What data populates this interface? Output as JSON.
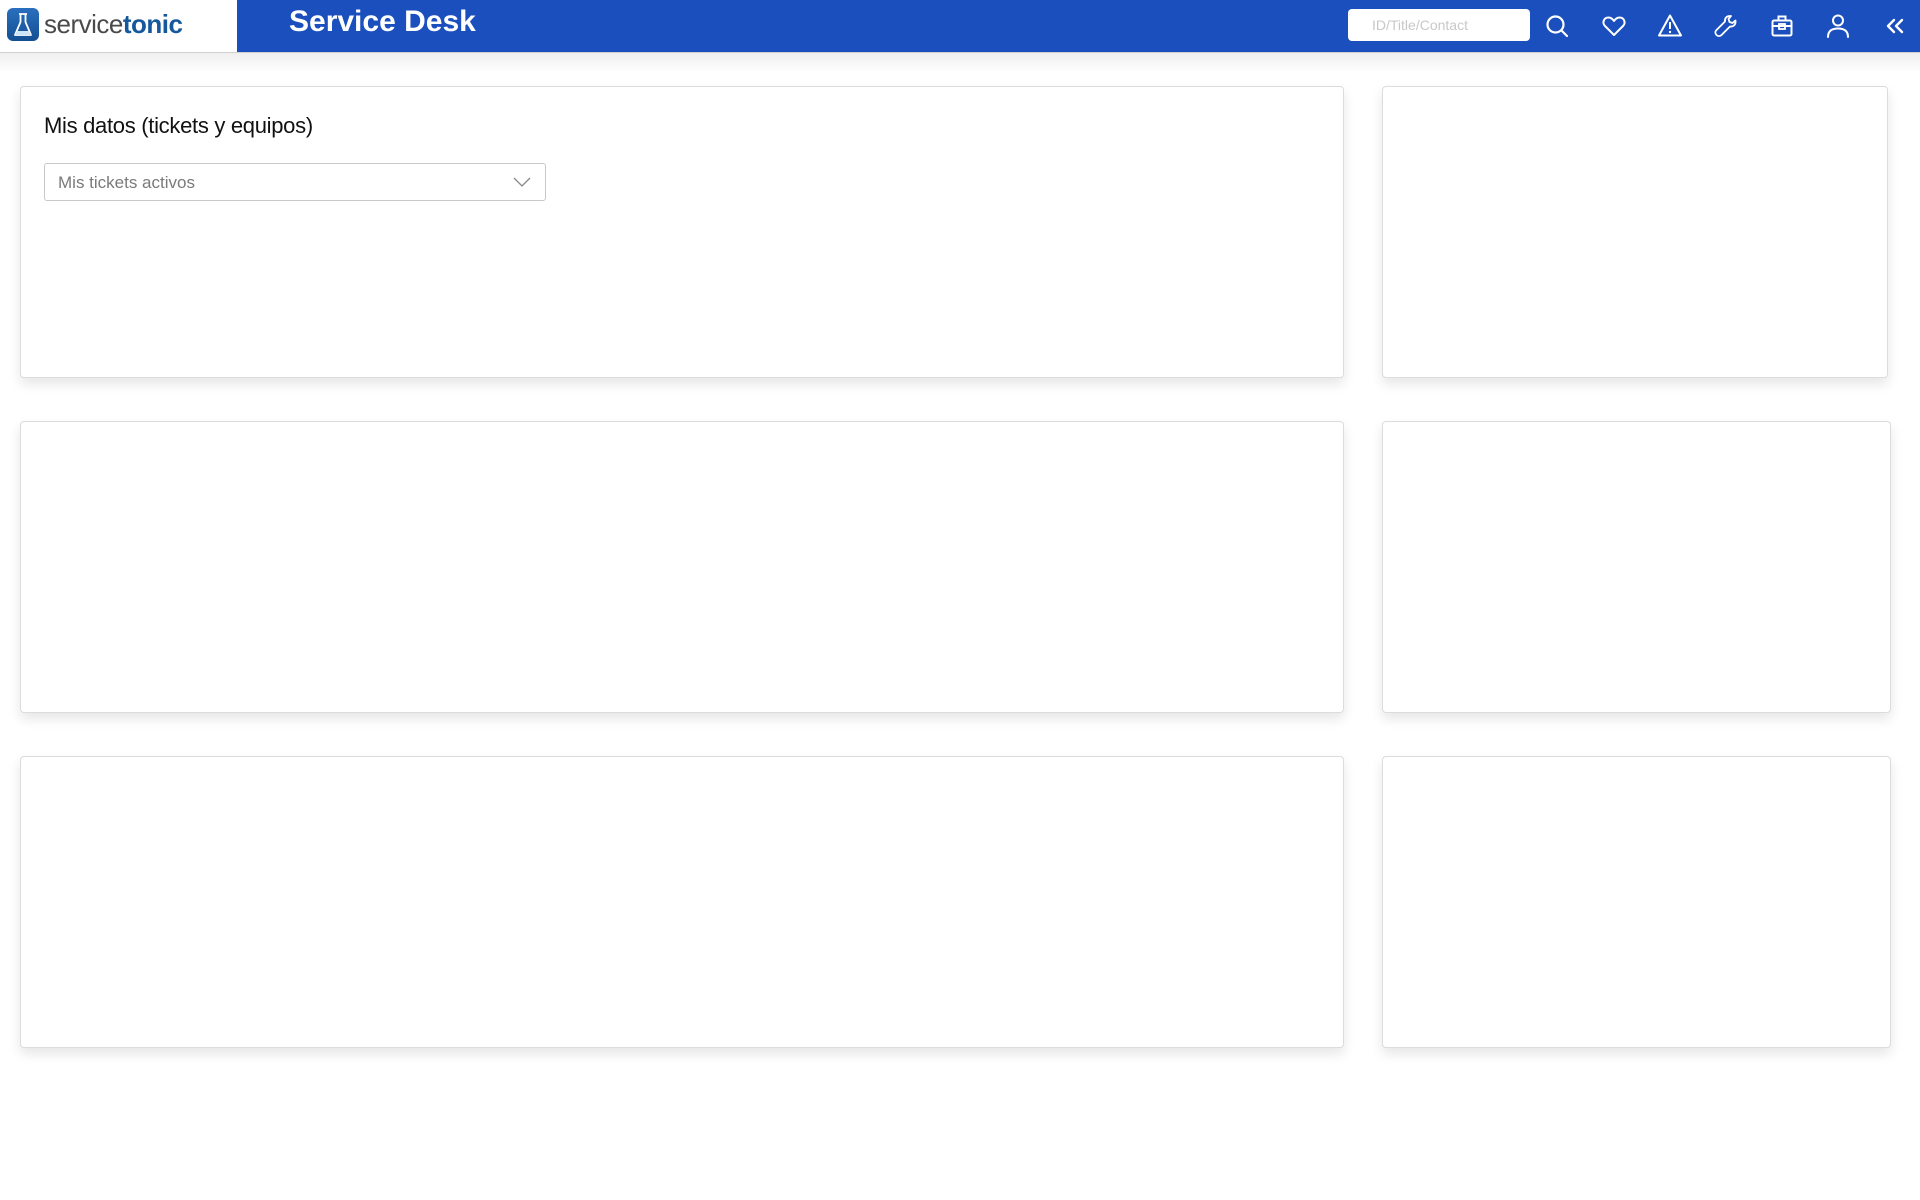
{
  "header": {
    "logo": {
      "part1": "service",
      "part2": "tonic",
      "icon": "flask-icon"
    },
    "title": "Service Desk",
    "search": {
      "placeholder": "ID/Title/Contact",
      "value": ""
    },
    "icons": [
      "search-icon",
      "heart-icon",
      "warning-icon",
      "wrench-icon",
      "briefcase-icon",
      "user-icon",
      "double-chevron-left-icon"
    ]
  },
  "dashboard": {
    "widget_main": {
      "title": "Mis datos (tickets y equipos)",
      "dropdown": {
        "selected": "Mis tickets activos"
      }
    }
  },
  "colors": {
    "header_blue": "#1a4fbd",
    "logo_blue": "#15589c"
  }
}
